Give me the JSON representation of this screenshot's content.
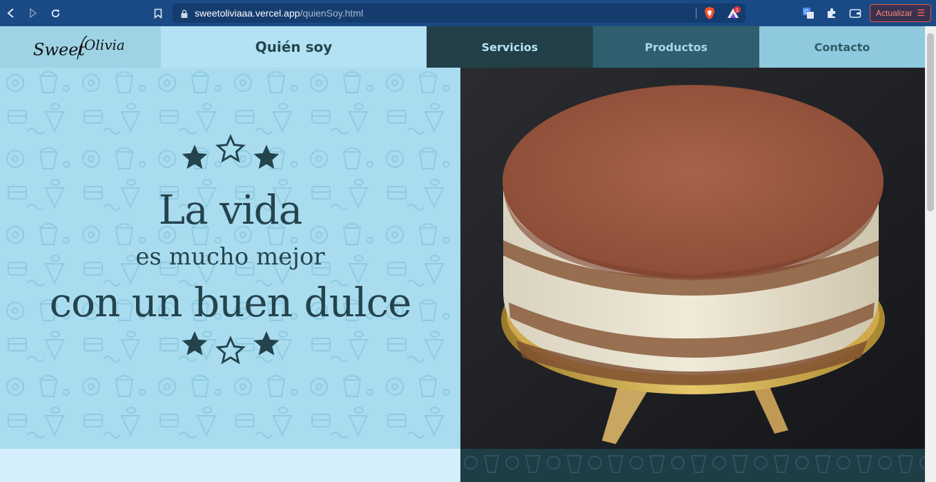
{
  "browser": {
    "url_host": "sweetoliviaaa.vercel.app",
    "url_path": "/quienSoy.html",
    "update_label": "Actualizar",
    "rewards_badge": "1"
  },
  "site": {
    "logo_text": "Sweet Olivia",
    "nav": [
      {
        "label": "Quién soy"
      },
      {
        "label": "Servicios"
      },
      {
        "label": "Productos"
      },
      {
        "label": "Contacto"
      }
    ]
  },
  "hero": {
    "line1": "La vida",
    "line2": "es mucho mejor",
    "line3": "con un buen dulce",
    "image": "tiramisu-cake-photo"
  },
  "colors": {
    "chrome": "#1a4a86",
    "hero_bg": "#a9dcef",
    "text_dark": "#24444d",
    "nav_servicios": "#233f48",
    "nav_productos": "#2f5f6e",
    "nav_contacto": "#8ec9dd"
  }
}
